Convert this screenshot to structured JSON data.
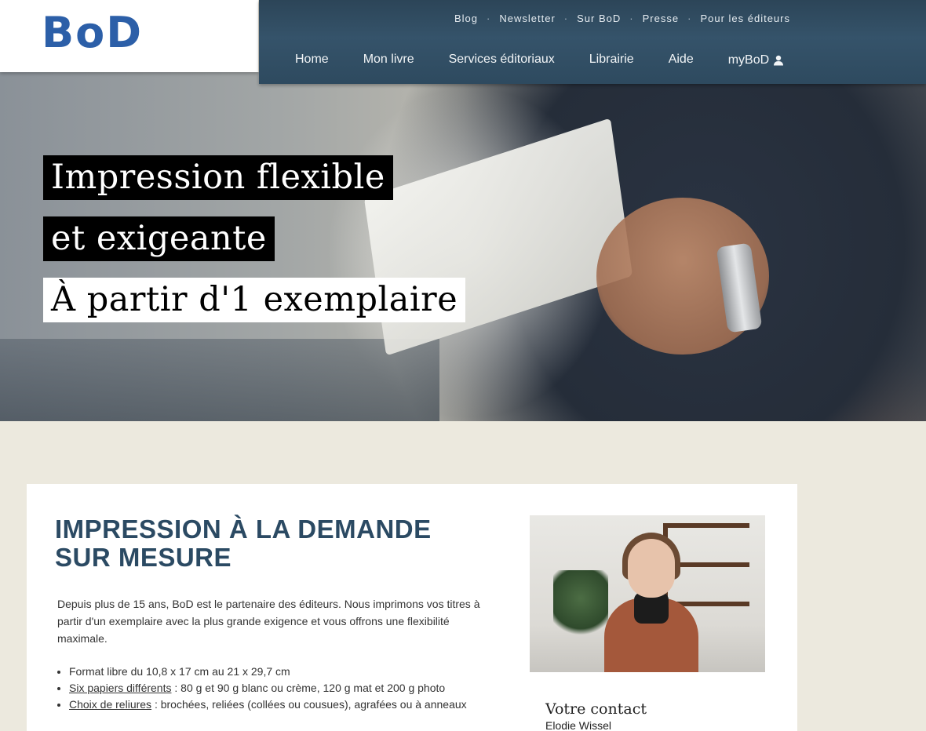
{
  "logo": {
    "text": "BoD"
  },
  "topnav": {
    "items": [
      "Blog",
      "Newsletter",
      "Sur BoD",
      "Presse",
      "Pour les éditeurs"
    ],
    "separator": "·"
  },
  "mainnav": {
    "items": [
      "Home",
      "Mon livre",
      "Services éditoriaux",
      "Librairie",
      "Aide"
    ],
    "mybod": "myBoD"
  },
  "hero": {
    "line1": "Impression flexible",
    "line2": "et exigeante",
    "line3": "À partir d'1 exemplaire"
  },
  "content": {
    "title": "IMPRESSION À LA DEMANDE SUR MESURE",
    "intro": "Depuis plus de 15 ans, BoD est le partenaire des éditeurs. Nous imprimons vos titres à partir d'un exemplaire avec la plus grande exigence et vous offrons une flexibilité maximale.",
    "features": [
      {
        "link": "",
        "text": "Format libre du 10,8 x 17 cm au 21 x 29,7 cm"
      },
      {
        "link": "Six papiers différents",
        "text": " : 80 g et 90 g blanc ou crème, 120 g mat et 200 g photo"
      },
      {
        "link": "Choix de reliures",
        "text": " : brochées, reliées (collées ou cousues), agrafées ou à anneaux"
      }
    ]
  },
  "contact": {
    "title": "Votre contact",
    "name": "Elodie Wissel"
  },
  "colors": {
    "brand_blue": "#2c5fa8",
    "nav_bg": "#35536a",
    "heading": "#2b4a63",
    "page_bg": "#ece9de"
  }
}
